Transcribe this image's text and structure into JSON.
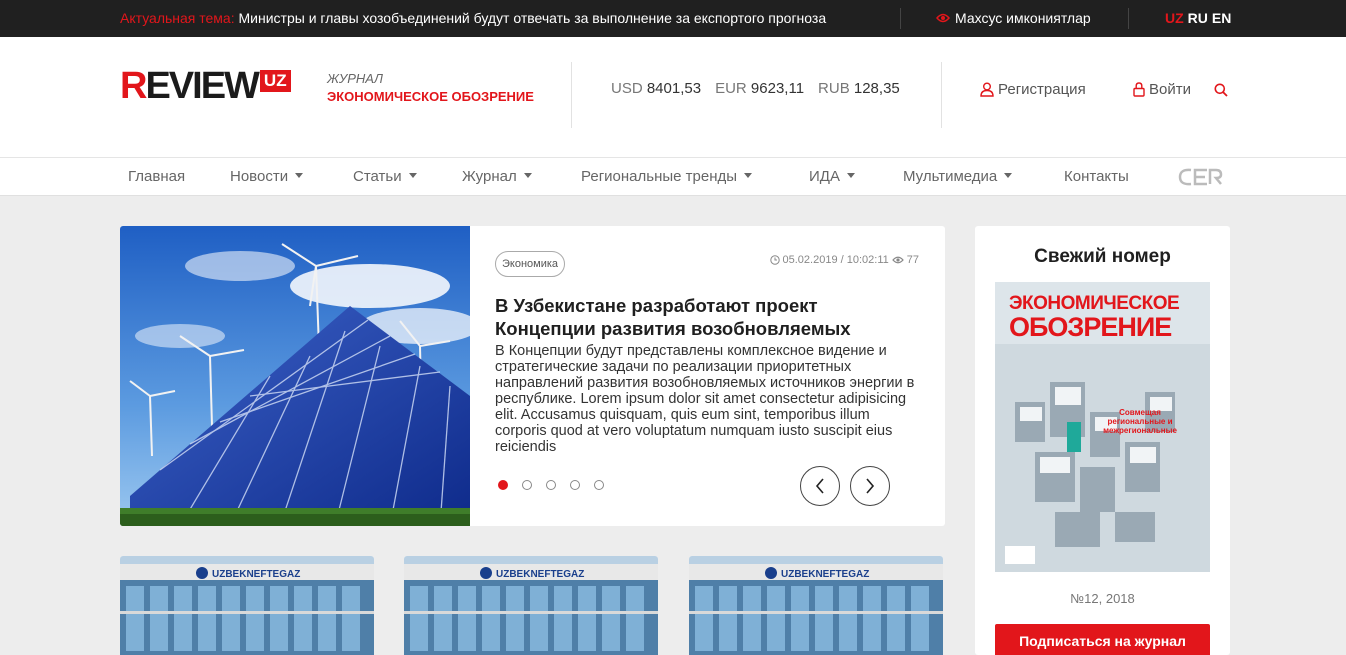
{
  "topbar": {
    "hot_label": "Актуальная тема:",
    "hot_text": "Министры и главы хозобъединений будут отвечать за выполнение за експортого прогноза",
    "special": "Махсус имкониятлар",
    "langs": [
      "UZ",
      "RU",
      "EN"
    ],
    "active_lang": "UZ"
  },
  "header": {
    "logo_word": "EVIEW",
    "logo_first": "R",
    "logo_uz": "UZ",
    "logo_line1": "ЖУРНАЛ",
    "logo_line2": "ЭКОНОМИЧЕСКОЕ ОБОЗРЕНИЕ",
    "rates": [
      {
        "code": "USD",
        "value": "8401,53"
      },
      {
        "code": "EUR",
        "value": "9623,11"
      },
      {
        "code": "RUB",
        "value": "128,35"
      }
    ],
    "register": "Регистрация",
    "login": "Войти"
  },
  "nav": {
    "items": [
      {
        "label": "Главная",
        "dropdown": false
      },
      {
        "label": "Новости",
        "dropdown": true
      },
      {
        "label": "Статьи",
        "dropdown": true
      },
      {
        "label": "Журнал",
        "dropdown": true
      },
      {
        "label": "Региональные тренды",
        "dropdown": true
      },
      {
        "label": "ИДА",
        "dropdown": true
      },
      {
        "label": "Мультимедиа",
        "dropdown": true
      },
      {
        "label": "Контакты",
        "dropdown": false
      }
    ]
  },
  "hero": {
    "tag": "Экономика",
    "date": "05.02.2019 / 10:02:11",
    "views": "77",
    "title": "В Узбекистане разработают проект Концепции развития возобновляемых",
    "text": "В Концепции будут представлены комплексное видение и стратегические задачи по реализации приоритетных направлений развития возобновляемых источников энергии в республике. Lorem ipsum dolor sit amet consectetur adipisicing elit. Accusamus quisquam, quis eum sint, temporibus illum corporis quod at vero voluptatum numquam iusto suscipit eius reiciendis",
    "slide_count": 5,
    "active_slide": 1
  },
  "cards": [
    {
      "sign": "UZBEKNEFTEGAZ"
    },
    {
      "sign": "UZBEKNEFTEGAZ"
    },
    {
      "sign": "UZBEKNEFTEGAZ"
    }
  ],
  "sidebar": {
    "title": "Свежий номер",
    "cover_title1": "ЭКОНОМИЧЕСКОЕ",
    "cover_title2": "ОБОЗРЕНИЕ",
    "cover_sub": "Совмещая региональные и межрегиональные",
    "issue": "№12, 2018",
    "subscribe": "Подписаться на журнал"
  },
  "colors": {
    "accent": "#e2161b",
    "topbar": "#202020",
    "background": "#ededed"
  }
}
